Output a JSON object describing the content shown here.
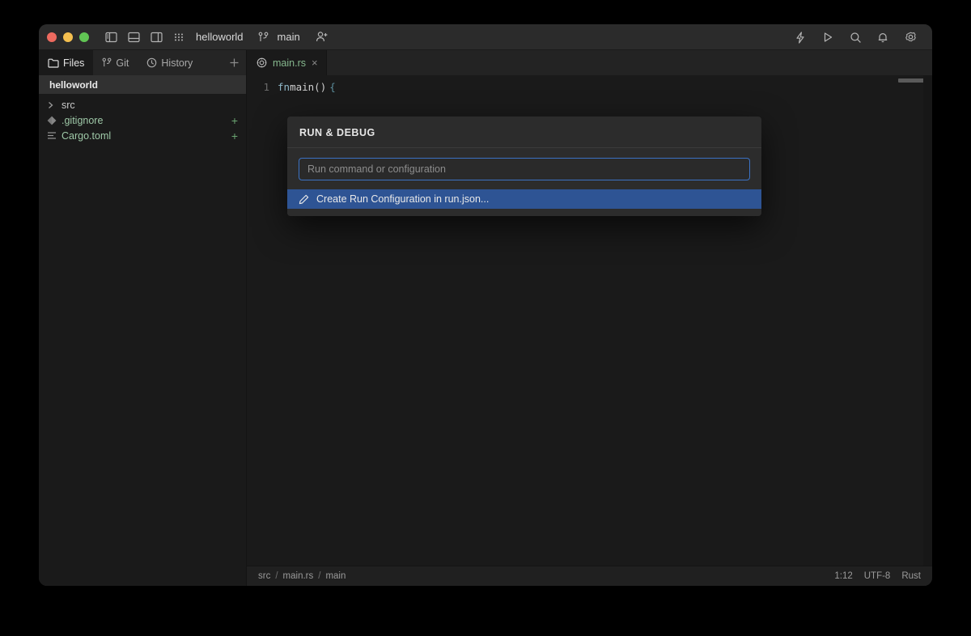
{
  "titlebar": {
    "project_name": "helloworld",
    "branch": "main",
    "icons": {
      "left_panel": "left-panel-icon",
      "bottom_panel": "bottom-panel-icon",
      "right_panel": "right-panel-icon",
      "grid": "grid-apps-icon",
      "branch": "git-branch-icon",
      "add_collaborator": "add-collaborator-icon",
      "lightning": "lightning-icon",
      "run": "run-play-icon",
      "search": "search-icon",
      "notifications": "bell-icon",
      "settings": "gear-icon"
    }
  },
  "sidebar": {
    "tabs": [
      {
        "label": "Files",
        "icon": "folder-icon",
        "active": true
      },
      {
        "label": "Git",
        "icon": "git-branch-icon",
        "active": false
      },
      {
        "label": "History",
        "icon": "clock-icon",
        "active": false
      }
    ],
    "add_tab_label": "+",
    "project_header": "helloworld",
    "tree": [
      {
        "label": "src",
        "icon": "chevron-right-icon",
        "type": "folder",
        "badge": ""
      },
      {
        "label": ".gitignore",
        "icon": "git-file-icon",
        "type": "file",
        "badge": "+"
      },
      {
        "label": "Cargo.toml",
        "icon": "toml-file-icon",
        "type": "file",
        "badge": "+"
      }
    ]
  },
  "editor": {
    "tab": {
      "label": "main.rs",
      "icon": "rust-icon",
      "close": "×"
    },
    "code": {
      "line_number": "1",
      "kw": "fn",
      "fn_name": " main()",
      "brace": "{"
    }
  },
  "statusbar": {
    "breadcrumb": [
      "src",
      "main.rs",
      "main"
    ],
    "separator": "/",
    "cursor": "1:12",
    "encoding": "UTF-8",
    "language": "Rust"
  },
  "dialog": {
    "title": "RUN & DEBUG",
    "input_placeholder": "Run command or configuration",
    "input_value": "",
    "item_label": "Create Run Configuration in run.json...",
    "item_icon": "pencil-icon"
  },
  "colors": {
    "accent_blue": "#3b72c4",
    "selection_blue": "#2e5494",
    "green_text": "#86b88e",
    "git_add_green": "#6ba572"
  }
}
